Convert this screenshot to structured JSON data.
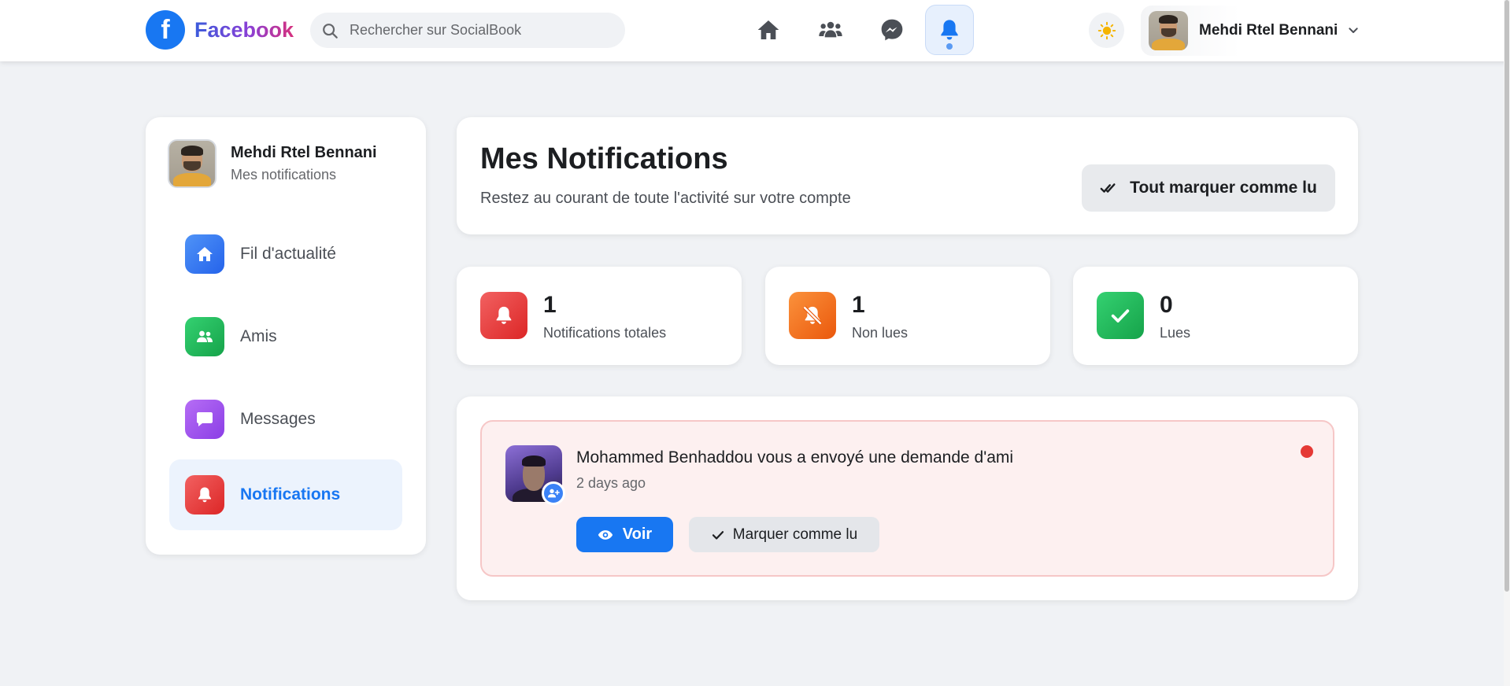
{
  "brand": {
    "name": "Facebook",
    "logo_letter": "f",
    "color": "#1877f2"
  },
  "search": {
    "placeholder": "Rechercher sur SocialBook",
    "value": ""
  },
  "top_nav": {
    "items": [
      {
        "name": "home-icon",
        "active": false
      },
      {
        "name": "friends-icon",
        "active": false
      },
      {
        "name": "messenger-icon",
        "active": false
      },
      {
        "name": "bell-icon",
        "active": true
      }
    ],
    "theme_icon": "sun-icon"
  },
  "user": {
    "name": "Mehdi Rtel Bennani"
  },
  "sidebar": {
    "profile_name": "Mehdi Rtel Bennani",
    "profile_sub": "Mes notifications",
    "items": [
      {
        "label": "Fil d'actualité",
        "icon": "home-icon",
        "color": "#3b82f6",
        "active": false
      },
      {
        "label": "Amis",
        "icon": "friends-icon",
        "color": "#22c55e",
        "active": false
      },
      {
        "label": "Messages",
        "icon": "message-icon",
        "color": "#a855f7",
        "active": false
      },
      {
        "label": "Notifications",
        "icon": "bell-icon",
        "color": "#ef4444",
        "active": true
      }
    ]
  },
  "header": {
    "title": "Mes Notifications",
    "subtitle": "Restez au courant de toute l'activité sur votre compte",
    "mark_all_label": "Tout marquer comme lu"
  },
  "stats": [
    {
      "value": "1",
      "label": "Notifications totales",
      "icon": "bell-icon",
      "color": "#ef4444"
    },
    {
      "value": "1",
      "label": "Non lues",
      "icon": "bell-slash-icon",
      "color": "#f97316"
    },
    {
      "value": "0",
      "label": "Lues",
      "icon": "check-icon",
      "color": "#22c55e"
    }
  ],
  "notifications": [
    {
      "text": "Mohammed Benhaddou vous a envoyé une demande d'ami",
      "time": "2 days ago",
      "unread": true,
      "view_label": "Voir",
      "mark_label": "Marquer comme lu"
    }
  ]
}
